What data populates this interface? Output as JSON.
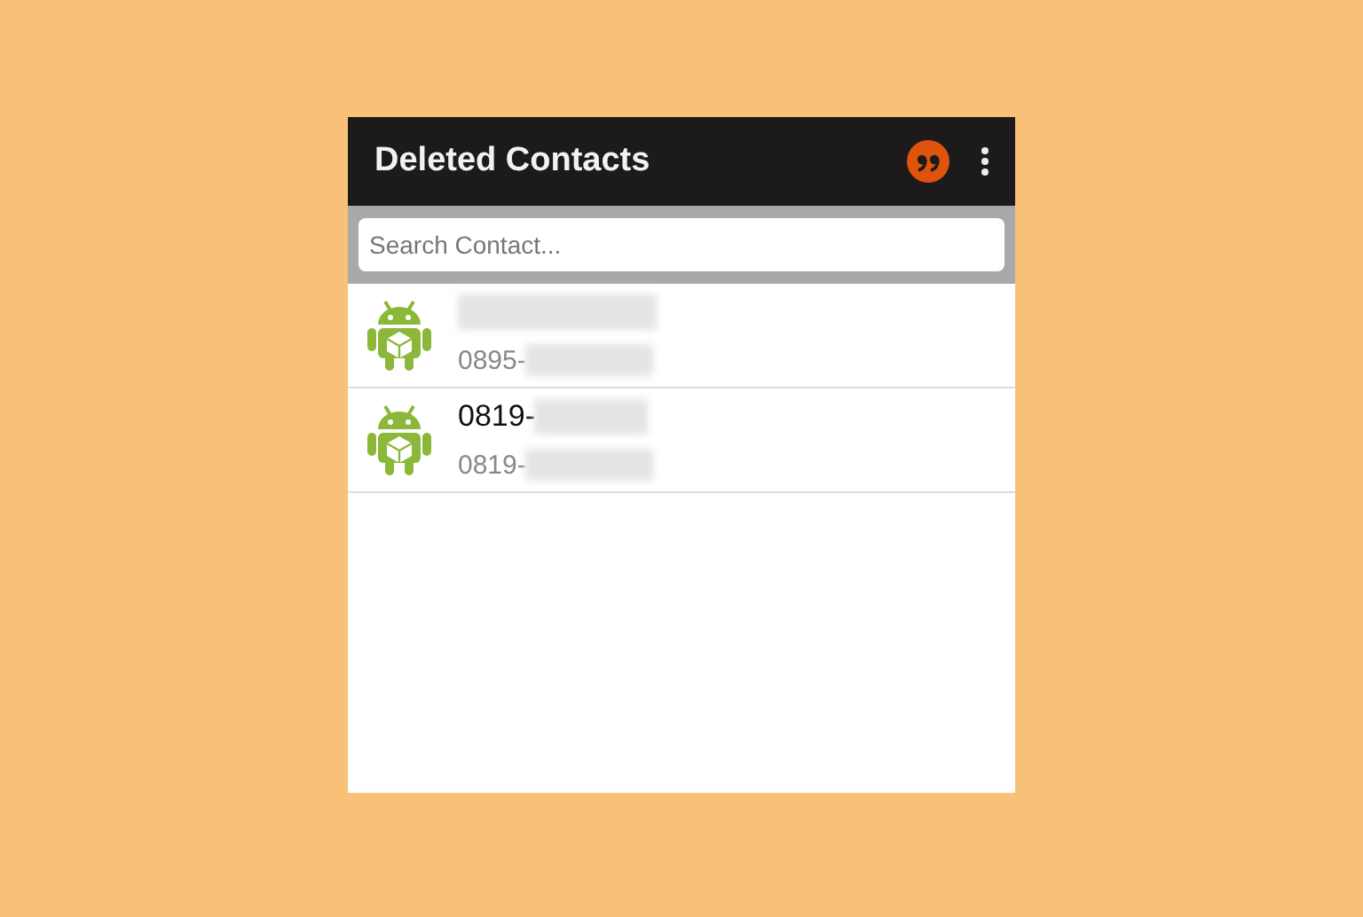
{
  "app_bar": {
    "title": "Deleted Contacts"
  },
  "search": {
    "placeholder": "Search Contact..."
  },
  "contacts": [
    {
      "number": "0895-"
    },
    {
      "name": "0819-",
      "number": "0819-"
    }
  ]
}
